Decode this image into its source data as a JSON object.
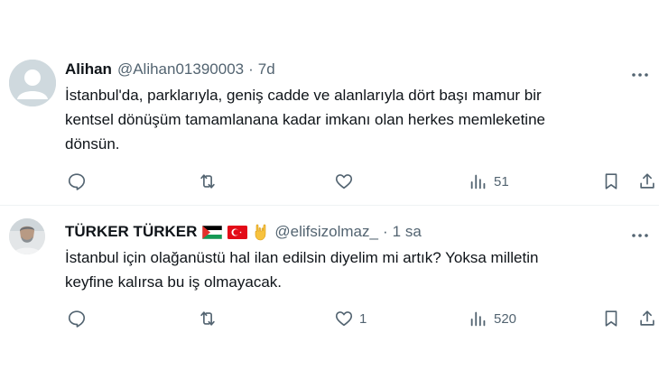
{
  "tweets": [
    {
      "author": "Alihan",
      "handle": "@Alihan01390003",
      "separator": "·",
      "time": "7d",
      "text": "İstanbul'da,  parklarıyla, geniş cadde ve alanlarıyla dört başı mamur bir\nkentsel dönüşüm tamamlanana kadar imkanı olan herkes memleketine\ndönsün.",
      "replies": "",
      "retweets": "",
      "likes": "",
      "views": "51"
    },
    {
      "author": "TÜRKER TÜRKER",
      "handle": "@elifsizolmaz_",
      "separator": "·",
      "time": "1 sa",
      "text": "İstanbul için olağanüstü hal ilan edilsin diyelim mi artık? Yoksa milletin\nkeyfine kalırsa bu iş olmayacak.",
      "replies": "",
      "retweets": "",
      "likes": "1",
      "views": "520"
    }
  ],
  "colors": {
    "text": "#0f1419",
    "secondary": "#536471",
    "divider": "#eff3f4",
    "avatar_default": "#cfd9de"
  },
  "icons": [
    "reply-icon",
    "retweet-icon",
    "like-icon",
    "views-icon",
    "bookmark-icon",
    "share-icon",
    "more-icon"
  ]
}
